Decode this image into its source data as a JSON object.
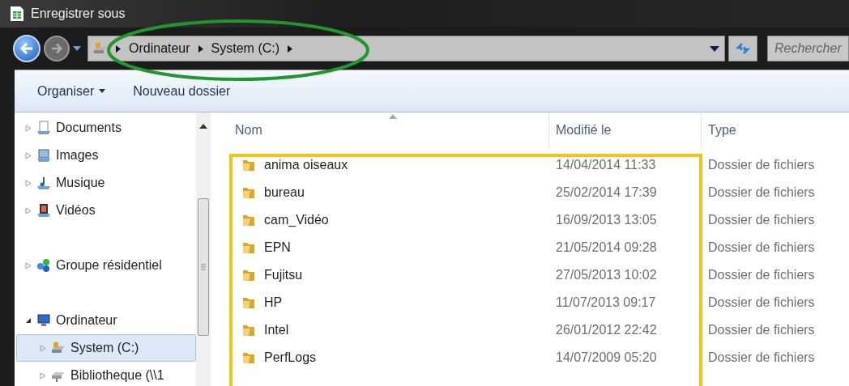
{
  "window": {
    "title": "Enregistrer sous"
  },
  "address_bar": {
    "breadcrumb": [
      "Ordinateur",
      "System (C:)"
    ]
  },
  "search": {
    "placeholder": "Rechercher"
  },
  "toolbar": [
    {
      "label": "Organiser",
      "kind": "menu"
    },
    {
      "label": "Nouveau dossier",
      "kind": "button"
    }
  ],
  "sidebar": {
    "groups": [
      [
        {
          "label": "Documents",
          "kind": "documents",
          "expanded": false,
          "selected": false
        },
        {
          "label": "Images",
          "kind": "images",
          "expanded": false,
          "selected": false
        },
        {
          "label": "Musique",
          "kind": "music",
          "expanded": false,
          "selected": false
        },
        {
          "label": "Vidéos",
          "kind": "videos",
          "expanded": false,
          "selected": false
        }
      ],
      [
        {
          "label": "Groupe résidentiel",
          "kind": "homegroup",
          "expanded": false,
          "selected": false
        }
      ],
      [
        {
          "label": "Ordinateur",
          "kind": "computer",
          "expanded": true,
          "selected": false,
          "children": [
            {
              "label": "System (C:)",
              "kind": "drive",
              "expanded": false,
              "selected": true
            },
            {
              "label": "Bibliotheque (\\\\1",
              "kind": "network-drive",
              "expanded": false,
              "selected": false
            }
          ]
        }
      ]
    ]
  },
  "table": {
    "columns": [
      {
        "label": "Nom",
        "sorted": true
      },
      {
        "label": "Modifié le"
      },
      {
        "label": "Type"
      }
    ],
    "rows": [
      [
        "anima oiseaux",
        "14/04/2014 11:33",
        "Dossier de fichiers"
      ],
      [
        "bureau",
        "25/02/2014 17:39",
        "Dossier de fichiers"
      ],
      [
        "cam_Vidéo",
        "16/09/2013 13:05",
        "Dossier de fichiers"
      ],
      [
        "EPN",
        "21/05/2014 09:28",
        "Dossier de fichiers"
      ],
      [
        "Fujitsu",
        "27/05/2013 10:02",
        "Dossier de fichiers"
      ],
      [
        "HP",
        "11/07/2013 09:17",
        "Dossier de fichiers"
      ],
      [
        "Intel",
        "26/01/2012 22:42",
        "Dossier de fichiers"
      ],
      [
        "PerfLogs",
        "14/07/2009 05:20",
        "Dossier de fichiers"
      ]
    ]
  }
}
